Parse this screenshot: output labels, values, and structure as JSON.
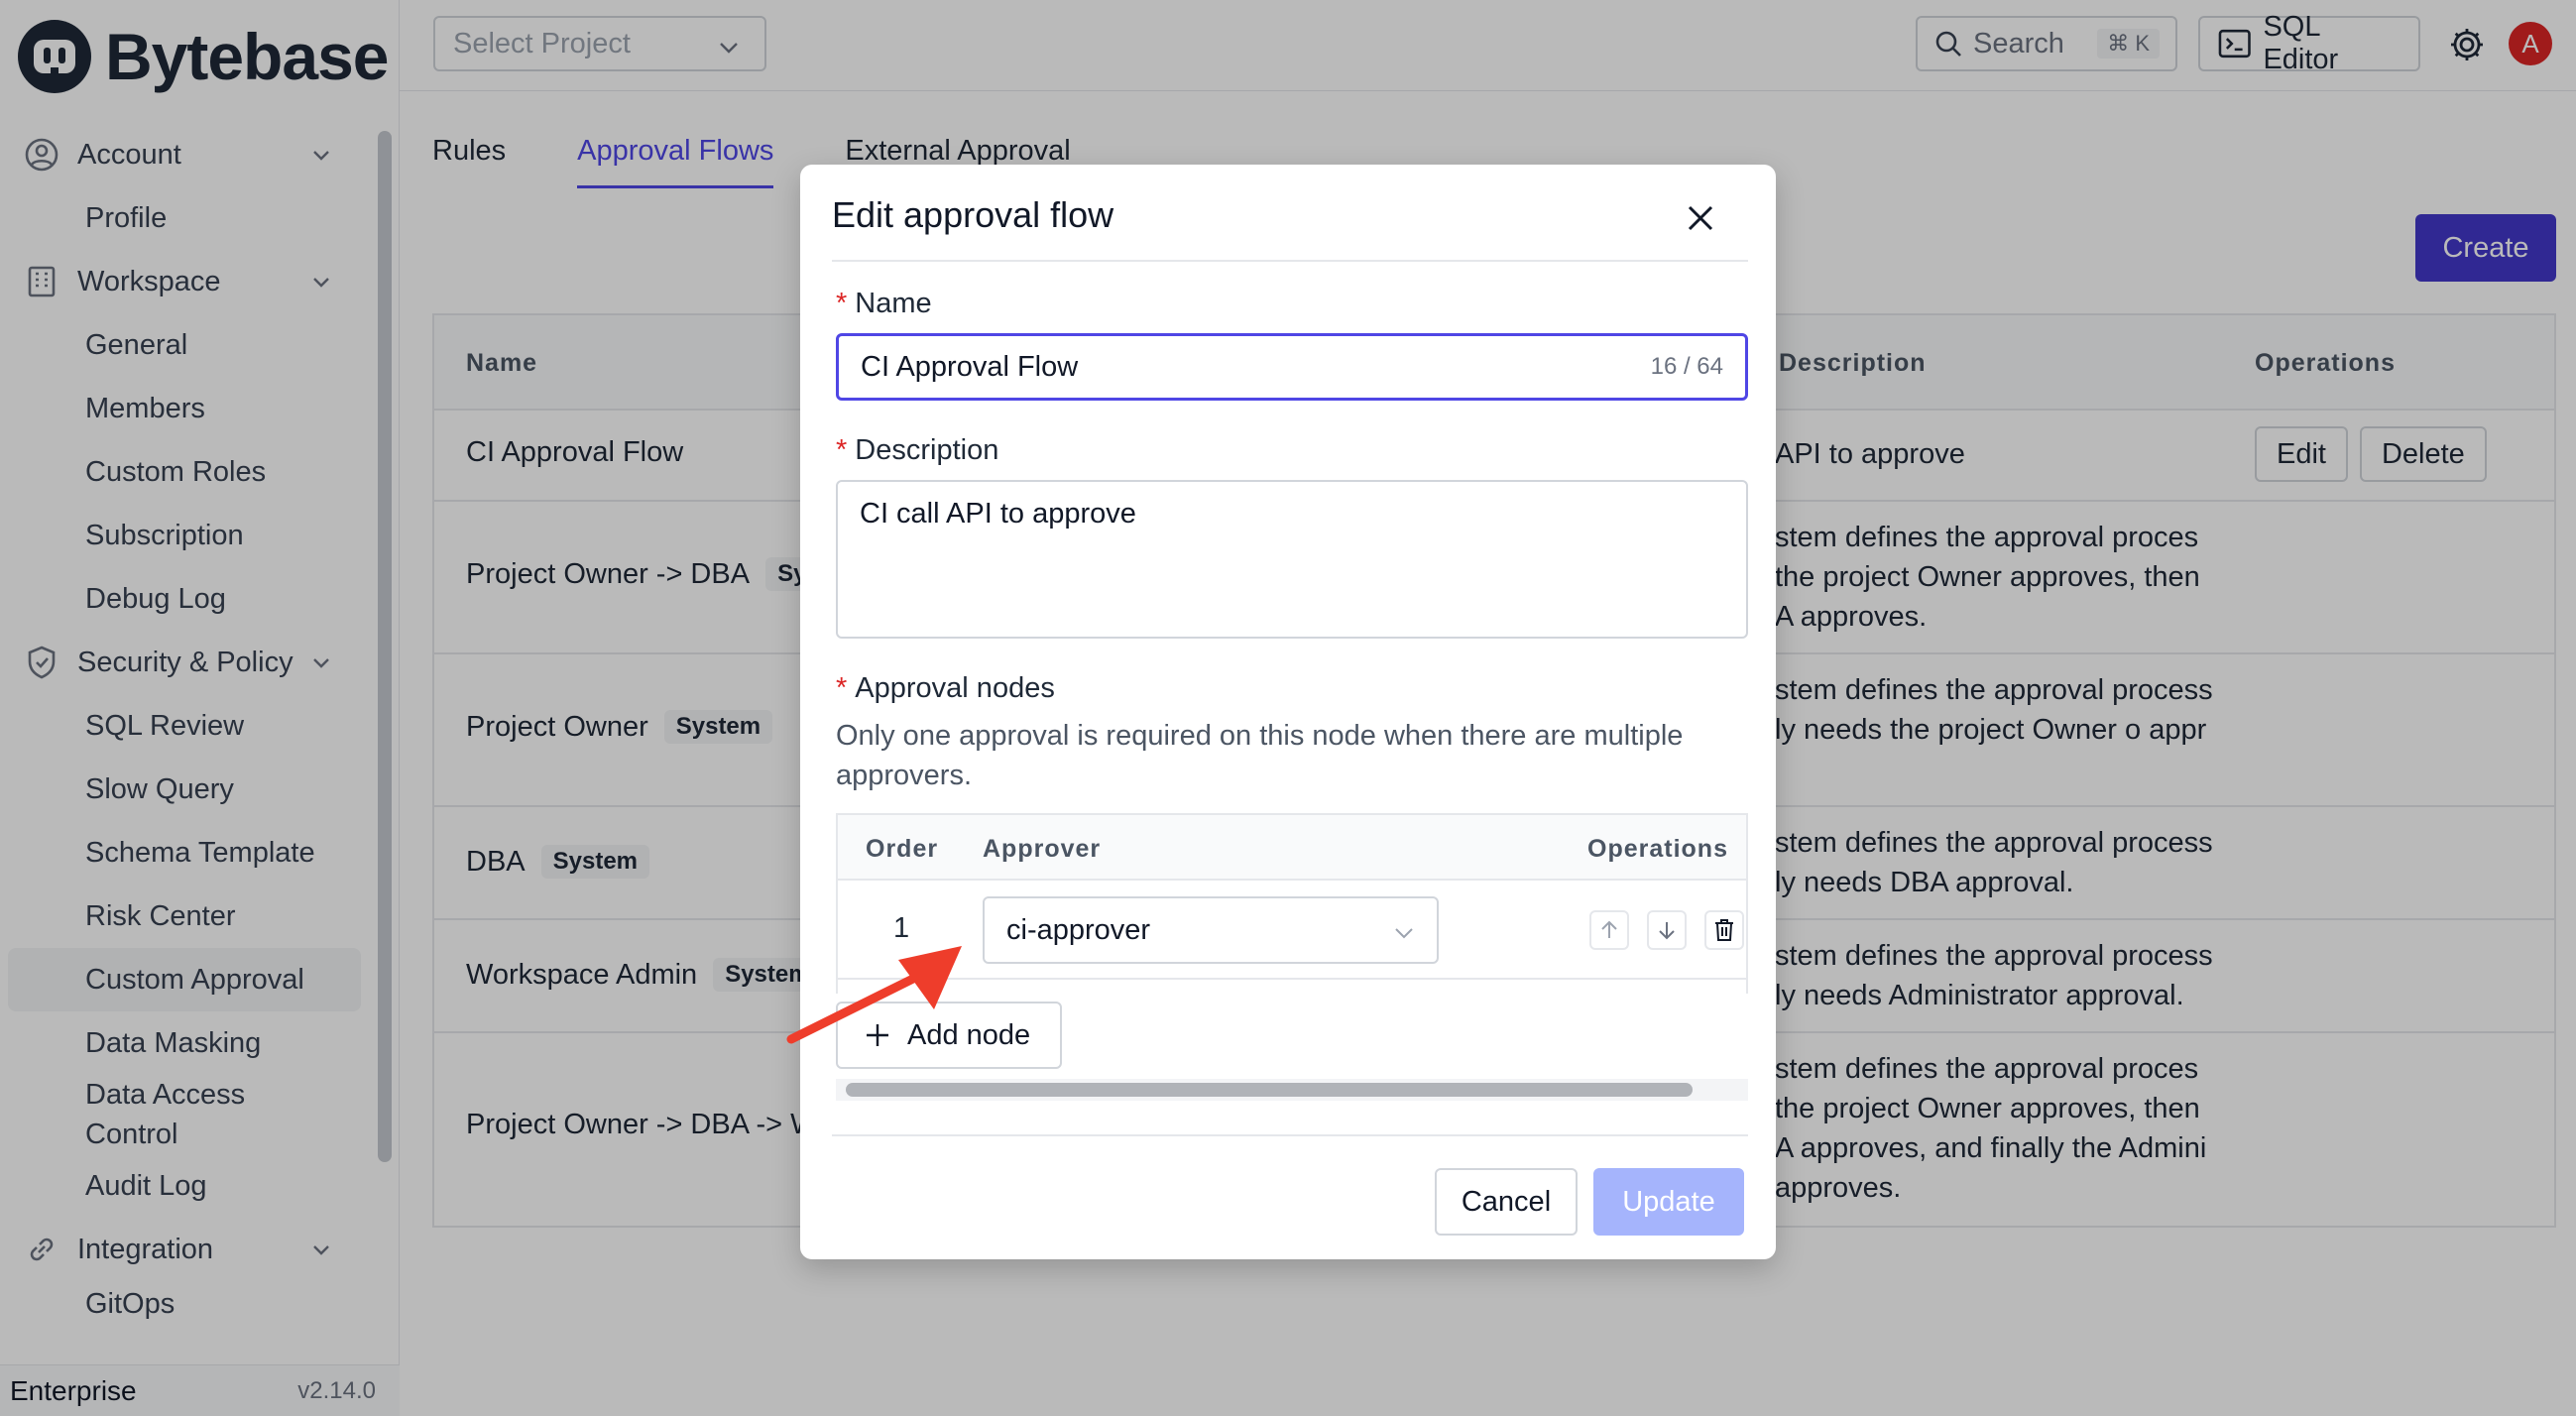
{
  "brand": {
    "name": "Bytebase"
  },
  "sidebar": {
    "groups": [
      {
        "label": "Account",
        "items": [
          "Profile"
        ]
      },
      {
        "label": "Workspace",
        "items": [
          "General",
          "Members",
          "Custom Roles",
          "Subscription",
          "Debug Log"
        ]
      },
      {
        "label": "Security & Policy",
        "items": [
          "SQL Review",
          "Slow Query",
          "Schema Template",
          "Risk Center",
          "Custom Approval",
          "Data Masking",
          "Data Access Control",
          "Audit Log"
        ]
      },
      {
        "label": "Integration",
        "items": [
          "GitOps"
        ]
      }
    ],
    "active_item": "Custom Approval",
    "footer": {
      "plan": "Enterprise",
      "version": "v2.14.0"
    }
  },
  "header": {
    "project_select_placeholder": "Select Project",
    "search_label": "Search",
    "search_shortcut": "⌘ K",
    "sql_editor_label": "SQL Editor",
    "avatar_letter": "A"
  },
  "main": {
    "tabs": [
      "Rules",
      "Approval Flows",
      "External Approval"
    ],
    "active_tab": "Approval Flows",
    "create_label": "Create",
    "columns": {
      "name": "Name",
      "description": "Description",
      "operations": "Operations"
    },
    "rows": [
      {
        "name": "CI Approval Flow",
        "badge": "",
        "description": [
          "API to approve"
        ],
        "ops": [
          "Edit",
          "Delete"
        ]
      },
      {
        "name": "Project Owner -> DBA",
        "badge": "Sy",
        "description": [
          "stem defines the approval proces",
          "the project Owner approves, then",
          "A approves."
        ],
        "ops": []
      },
      {
        "name": "Project Owner",
        "badge": "System",
        "description": [
          "stem defines the approval process",
          "ly needs the project Owner o appr"
        ],
        "ops": []
      },
      {
        "name": "DBA",
        "badge": "System",
        "description": [
          "stem defines the approval process",
          "ly needs DBA approval."
        ],
        "ops": []
      },
      {
        "name": "Workspace Admin",
        "badge": "System",
        "description": [
          "stem defines the approval process",
          "ly needs Administrator approval."
        ],
        "ops": []
      },
      {
        "name": "Project Owner -> DBA -> W",
        "badge": "",
        "description": [
          "stem defines the approval proces",
          "the project Owner approves, then",
          "A approves, and finally the Admini",
          "approves."
        ],
        "ops": []
      }
    ]
  },
  "dialog": {
    "title": "Edit approval flow",
    "name_label": "Name",
    "name_value": "CI Approval Flow",
    "name_count": "16 / 64",
    "description_label": "Description",
    "description_value": "CI call API to approve",
    "nodes_label": "Approval nodes",
    "nodes_hint": "Only one approval is required on this node when there are multiple approvers.",
    "nodes_columns": {
      "order": "Order",
      "approver": "Approver",
      "operations": "Operations"
    },
    "nodes": [
      {
        "order": "1",
        "approver": "ci-approver"
      }
    ],
    "add_node_label": "Add node",
    "cancel_label": "Cancel",
    "update_label": "Update"
  },
  "colors": {
    "accent": "#4f46e5",
    "create_bg": "#4338ca",
    "update_disabled": "#a5b4fc",
    "annotation_arrow": "#ee3d2b",
    "required": "#dc2626"
  }
}
